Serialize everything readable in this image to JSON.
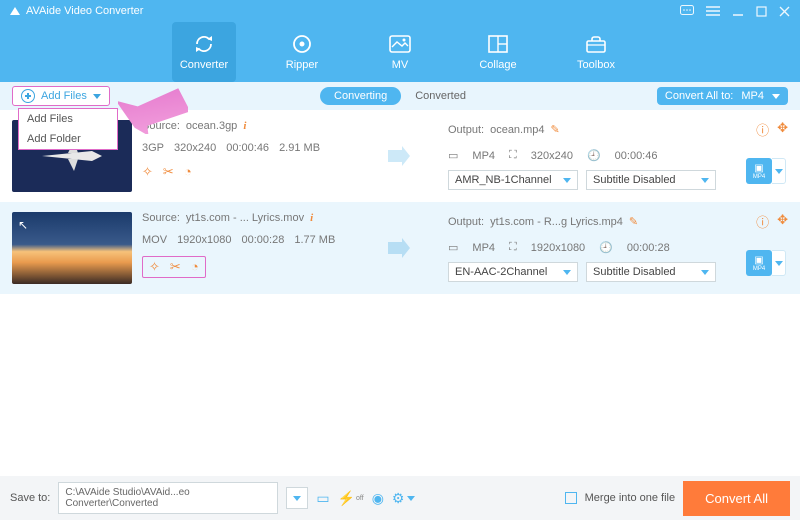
{
  "app_title": "AVAide Video Converter",
  "tabs": {
    "converter": "Converter",
    "ripper": "Ripper",
    "mv": "MV",
    "collage": "Collage",
    "toolbox": "Toolbox"
  },
  "add_files_label": "Add Files",
  "dropdown": {
    "add_files": "Add Files",
    "add_folder": "Add Folder"
  },
  "subtabs": {
    "converting": "Converting",
    "converted": "Converted"
  },
  "convert_all_label": "Convert All to:",
  "convert_all_value": "MP4",
  "rows": [
    {
      "source_label": "Source:",
      "source_name": "ocean.3gp",
      "fmt": "3GP",
      "res": "320x240",
      "dur": "00:00:46",
      "size": "2.91 MB",
      "output_label": "Output:",
      "output_name": "ocean.mp4",
      "out_fmt": "MP4",
      "out_res": "320x240",
      "out_dur": "00:00:46",
      "audio": "AMR_NB-1Channel",
      "subtitle": "Subtitle Disabled",
      "fmt_btn": "MP4"
    },
    {
      "source_label": "Source:",
      "source_name": "yt1s.com - ... Lyrics.mov",
      "fmt": "MOV",
      "res": "1920x1080",
      "dur": "00:00:28",
      "size": "1.77 MB",
      "output_label": "Output:",
      "output_name": "yt1s.com - R...g Lyrics.mp4",
      "out_fmt": "MP4",
      "out_res": "1920x1080",
      "out_dur": "00:00:28",
      "audio": "EN-AAC-2Channel",
      "subtitle": "Subtitle Disabled",
      "fmt_btn": "MP4"
    }
  ],
  "footer": {
    "save_to": "Save to:",
    "path": "C:\\AVAide Studio\\AVAid...eo Converter\\Converted",
    "merge": "Merge into one file",
    "convert": "Convert All"
  }
}
